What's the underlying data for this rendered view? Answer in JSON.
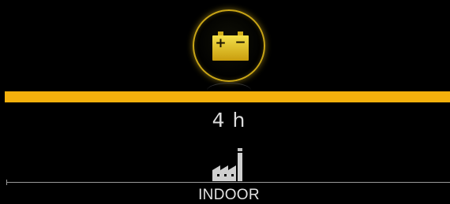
{
  "battery": {
    "icon": "battery-icon",
    "accent_color": "#c9a516",
    "plus_symbol": "+",
    "minus_symbol": "−"
  },
  "charge_progress": {
    "fraction": 1.0,
    "color": "#f5b10c"
  },
  "duration": {
    "value": "4 h"
  },
  "mode": {
    "icon": "factory-icon",
    "label": "INDOOR"
  }
}
